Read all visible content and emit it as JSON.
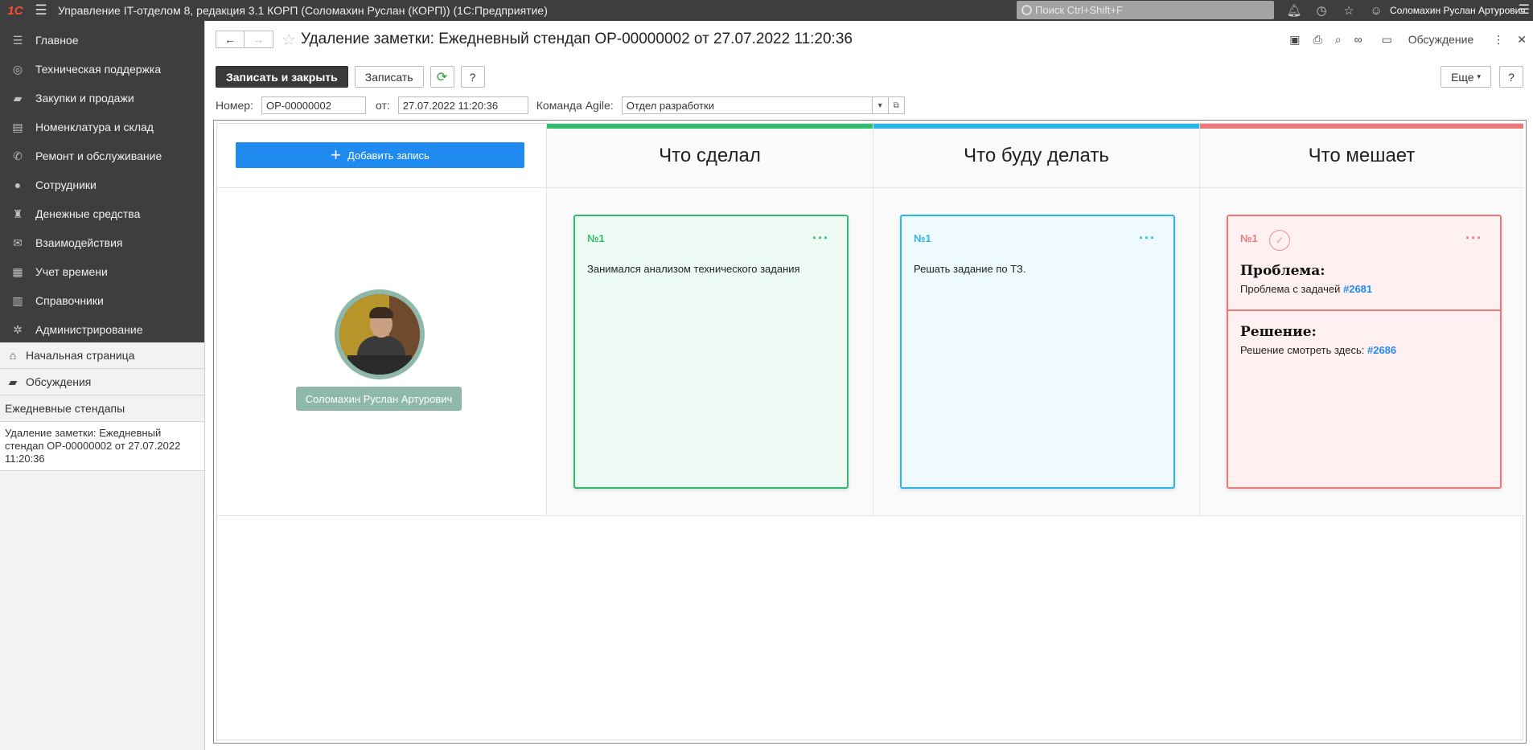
{
  "topbar": {
    "logo": "1С",
    "app_title": "Управление IT-отделом 8, редакция 3.1 КОРП (Соломахин Руслан (КОРП))  (1С:Предприятие)",
    "search_placeholder": "Поиск Ctrl+Shift+F",
    "user": "Соломахин Руслан Артурович"
  },
  "sidebar": {
    "sections": [
      {
        "label": "Главное",
        "icon": "menu-icon"
      },
      {
        "label": "Техническая поддержка",
        "icon": "support-icon"
      },
      {
        "label": "Закупки и продажи",
        "icon": "truck-icon"
      },
      {
        "label": "Номенклатура и склад",
        "icon": "warehouse-icon"
      },
      {
        "label": "Ремонт и обслуживание",
        "icon": "repair-icon"
      },
      {
        "label": "Сотрудники",
        "icon": "users-icon"
      },
      {
        "label": "Денежные средства",
        "icon": "money-icon"
      },
      {
        "label": "Взаимодействия",
        "icon": "mail-icon"
      },
      {
        "label": "Учет времени",
        "icon": "calendar-icon"
      },
      {
        "label": "Справочники",
        "icon": "books-icon"
      },
      {
        "label": "Администрирование",
        "icon": "gear-icon"
      }
    ],
    "home": "Начальная страница",
    "discussions": "Обсуждения",
    "standups": "Ежедневные стендапы",
    "active_window": "Удаление заметки: Ежедневный стендап ОР-00000002 от 27.07.2022 11:20:36"
  },
  "form": {
    "title": "Удаление заметки: Ежедневный стендап ОР-00000002 от 27.07.2022 11:20:36",
    "discussion_label": "Обсуждение",
    "save_close": "Записать и закрыть",
    "save": "Записать",
    "help": "?",
    "more": "Еще",
    "number_label": "Номер:",
    "number_value": "ОР-00000002",
    "date_label": "от:",
    "date_value": "27.07.2022 11:20:36",
    "team_label": "Команда Agile:",
    "team_value": "Отдел разработки"
  },
  "board": {
    "add_button": "Добавить запись",
    "employee": "Соломахин Руслан Артурович",
    "columns": [
      {
        "title": "Что сделал",
        "color": "#2ebd6b"
      },
      {
        "title": "Что буду делать",
        "color": "#29b6e8"
      },
      {
        "title": "Что мешает",
        "color": "#ee7777"
      }
    ],
    "done_card": {
      "num": "№1",
      "text": "Занимался анализом технического задания"
    },
    "todo_card": {
      "num": "№1",
      "text": "Решать задание по ТЗ."
    },
    "blocker_card": {
      "num": "№1",
      "problem_title": "Проблема:",
      "problem_text": "Проблема с задачей",
      "problem_link": "#2681",
      "solution_title": "Решение:",
      "solution_text": "Решение смотреть здесь:",
      "solution_link": "#2686"
    }
  }
}
